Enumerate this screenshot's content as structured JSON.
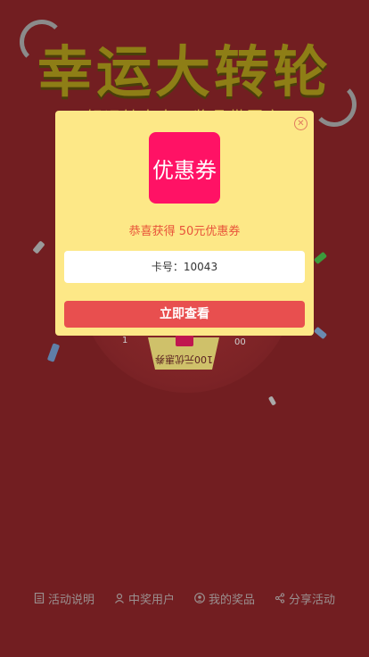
{
  "background": {
    "title": "幸运大转轮",
    "subtitle": "好运转出来，奖品带回家"
  },
  "wheel": {
    "bottom_prize": "100元优惠券",
    "side_left": "1",
    "side_right": "00"
  },
  "modal": {
    "prize_image_text": "优惠券",
    "message": "恭喜获得 50元优惠券",
    "card_number": "卡号：10043",
    "button_label": "立即查看"
  },
  "bottom_nav": [
    {
      "label": "活动说明",
      "icon": "document-icon"
    },
    {
      "label": "中奖用户",
      "icon": "user-icon"
    },
    {
      "label": "我的奖品",
      "icon": "user-circle-icon"
    },
    {
      "label": "分享活动",
      "icon": "share-icon"
    }
  ],
  "colors": {
    "background": "#721e21",
    "modal_bg": "#fde887",
    "prize_image": "#ff1265",
    "button": "#e84f4f",
    "message": "#e8533a"
  }
}
